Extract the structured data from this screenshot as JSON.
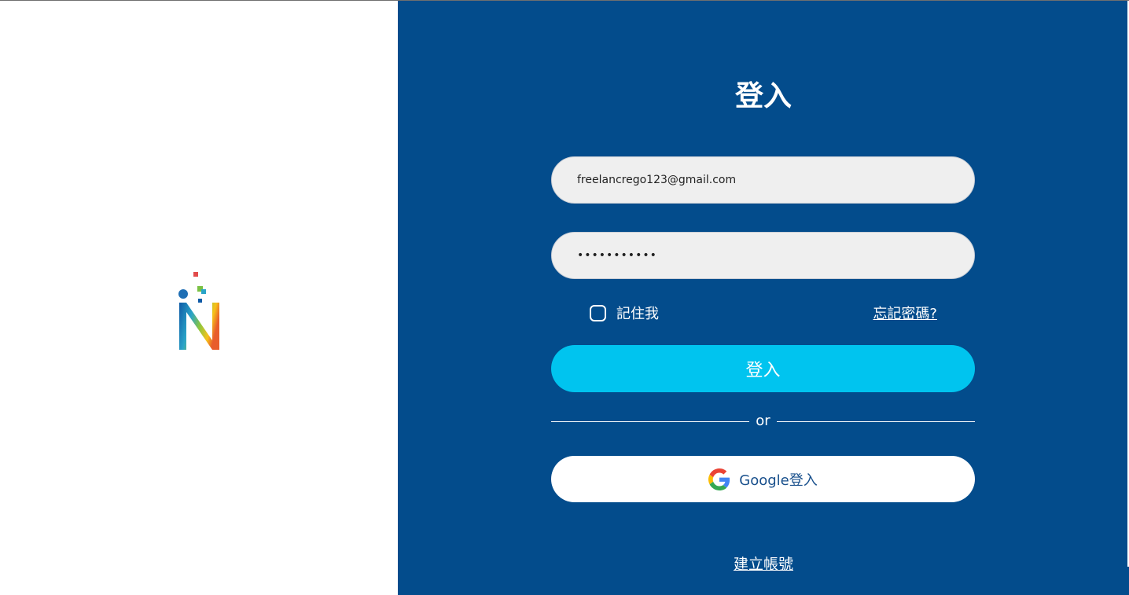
{
  "logo": {
    "icon": "n-logo-icon"
  },
  "form": {
    "title": "登入",
    "email_value": "freelancrego123@gmail.com",
    "password_value": "•••••••••••",
    "remember_label": "記住我",
    "forgot_label": "忘記密碼?",
    "login_button": "登入",
    "divider_text": "or",
    "google_button": "Google登入",
    "create_account": "建立帳號"
  },
  "colors": {
    "panel": "#034c8c",
    "accent": "#00c4ef",
    "field": "#efefef"
  }
}
